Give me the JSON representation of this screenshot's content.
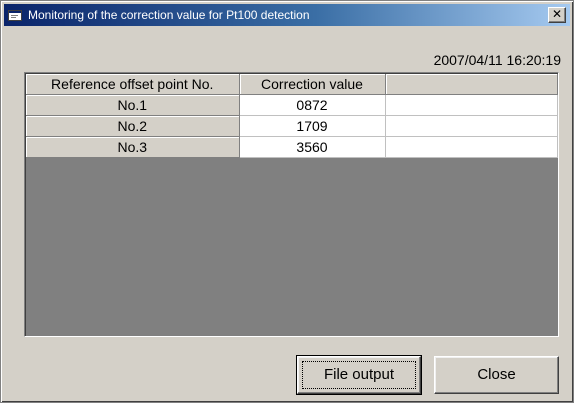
{
  "window": {
    "title": "Monitoring of the correction value for Pt100 detection",
    "icon": "app-window-icon",
    "close_glyph": "✕"
  },
  "timestamp": "2007/04/11 16:20:19",
  "table": {
    "columns": [
      "Reference offset point No.",
      "Correction value",
      ""
    ],
    "rows": [
      {
        "point": "No.1",
        "value": "0872"
      },
      {
        "point": "No.2",
        "value": "1709"
      },
      {
        "point": "No.3",
        "value": "3560"
      }
    ]
  },
  "buttons": {
    "file_output": "File output",
    "close": "Close"
  }
}
